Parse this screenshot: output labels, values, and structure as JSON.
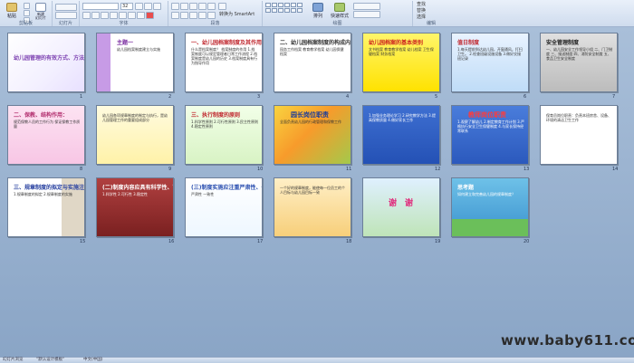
{
  "ribbon": {
    "paste_label": "粘贴",
    "new_slide_label": "新建\n幻灯片",
    "group_clipboard": "剪贴板",
    "group_slides": "幻灯片",
    "group_font": "字体",
    "group_paragraph": "段落",
    "group_drawing": "绘图",
    "group_editing": "编辑",
    "font_name": "",
    "font_size": "32",
    "smartart_label": "转换为 SmartArt",
    "arrange_label": "排列",
    "quick_styles_label": "快速样式",
    "find_label": "查找",
    "replace_label": "替换",
    "select_label": "选择"
  },
  "slides": [
    {
      "num": "1",
      "title": "幼儿园管理的有效方式、方法",
      "body": "",
      "theme": "pencil"
    },
    {
      "num": "2",
      "title": "主题一",
      "body": "幼儿园档案制度建立与实施",
      "theme": "purple"
    },
    {
      "num": "3",
      "title": "一、幼儿园档案制度及其作用",
      "body": "什么是档案制度？ 档案制度的作用 1.档案制度可以规定管理者日常工作流程 2.档案制度是幼儿园的历史 3.档案制度具有行为指导作用",
      "theme": "white"
    },
    {
      "num": "4",
      "title": "二、幼儿园档案制度的构成内容",
      "body": "园务工作档案 教育教学档案 幼儿园保健档案",
      "theme": "white2"
    },
    {
      "num": "5",
      "title": "幼儿园档案的基本类别",
      "body": "文书档案 教育教学档案 幼儿档案 卫生保健档案 财务档案",
      "theme": "yellow"
    },
    {
      "num": "6",
      "title": "值日制度",
      "body": "1.每天提前到达幼儿园，开窗通风，打扫卫生。 2.检查班级设施设备 3.做好交接班记录",
      "theme": "lightblue"
    },
    {
      "num": "7",
      "title": "安全管理制度",
      "body": "一、幼儿园安全工作领导小组 二、门卫制度 三、接送制度 四、消防安全制度 五、食品卫生安全制度",
      "theme": "gray"
    },
    {
      "num": "8",
      "title": "二、保教、结构作用：",
      "body": "规范保教人员的工作行为 保证保教工作质量",
      "theme": "pink"
    },
    {
      "num": "9",
      "title": "",
      "body": "幼儿园各项规章制度的制定与执行，是幼儿园管理工作的重要组成部分",
      "theme": "yellow2"
    },
    {
      "num": "10",
      "title": "三、执行制度的原则",
      "body": "1.科学性原则 2.可行性原则 3.民主性原则 4.稳定性原则",
      "theme": "green"
    },
    {
      "num": "11",
      "title": "园长岗位职责",
      "body": "全面负责幼儿园的行政管理和保教工作",
      "theme": "autumn"
    },
    {
      "num": "12",
      "title": "",
      "body": "1.加强业务理论学习 2.研究教学方法 3.提高保教质量 4.做好家长工作",
      "theme": "blue"
    },
    {
      "num": "13",
      "title": "教师岗位职责",
      "body": "1.观察了解幼儿 2.制定教育工作计划 3.严格执行安全卫生保健制度 4.与家长保持经常联系",
      "theme": "blue2"
    },
    {
      "num": "14",
      "title": "",
      "body": "保育员岗位职责：负责本班房舍、设备、环境的清洁卫生工作",
      "theme": "white3"
    },
    {
      "num": "15",
      "title": "三、规章制度的拟定与实施注意事项",
      "body": "1.规章制度的拟定 2.规章制度的实施",
      "theme": "shelf"
    },
    {
      "num": "16",
      "title": "(二)制度内容应具有科学性、可行性",
      "body": "1.科学性 2.可行性 3.稳定性",
      "theme": "maroon"
    },
    {
      "num": "17",
      "title": "(三)制度实施应注重严肃性、一致性",
      "body": "严肃性 一致性",
      "theme": "teeth"
    },
    {
      "num": "18",
      "title": "",
      "body": "一个好的规章制度，能使每一位员工的个人目标与幼儿园目标一致",
      "theme": "orange"
    },
    {
      "num": "19",
      "title": "谢　谢",
      "body": "",
      "theme": "house"
    },
    {
      "num": "20",
      "title": "思考题",
      "body": "如何建立和完善幼儿园的规章制度？",
      "theme": "bluegreen"
    }
  ],
  "watermark": "www.baby611.com",
  "status": {
    "slide_view": "幻灯片浏览",
    "theme_name": "\"默认设计模板\"",
    "language": "中文(中国)"
  },
  "colors": {
    "ribbon_top": "#e9f0fa",
    "sorter_bg": "#a0b8d6",
    "watermark": "#2b2b2b"
  }
}
